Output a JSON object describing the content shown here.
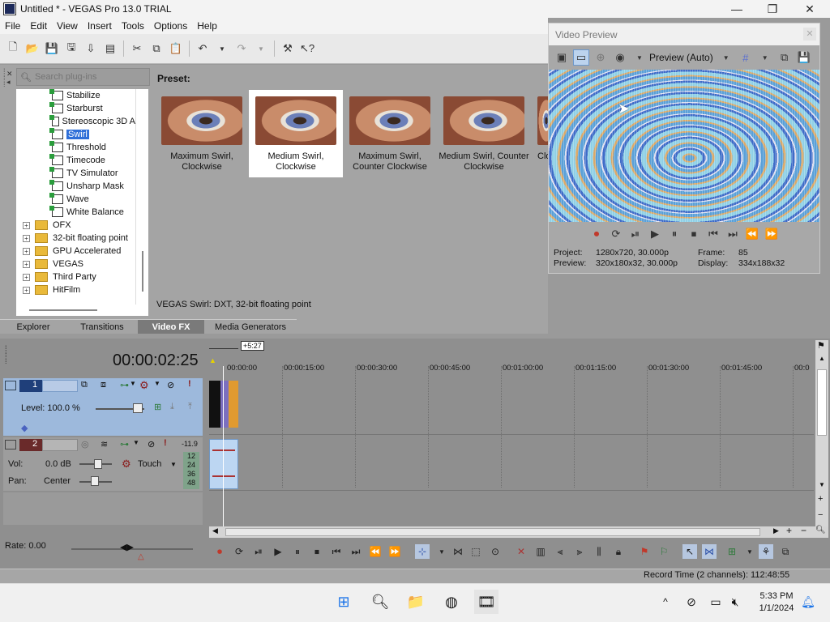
{
  "window": {
    "title": "Untitled * - VEGAS Pro 13.0 TRIAL",
    "minimize": "—",
    "maximize": "❐",
    "close": "✕"
  },
  "menu": [
    "File",
    "Edit",
    "View",
    "Insert",
    "Tools",
    "Options",
    "Help"
  ],
  "plugins": {
    "search_placeholder": "Search plug-ins",
    "fx_items": [
      "Stabilize",
      "Starburst",
      "Stereoscopic 3D A",
      "Swirl",
      "Threshold",
      "Timecode",
      "TV Simulator",
      "Unsharp Mask",
      "Wave",
      "White Balance"
    ],
    "selected": "Swirl",
    "folders": [
      "OFX",
      "32-bit floating point",
      "GPU Accelerated",
      "VEGAS",
      "Third Party",
      "HitFilm"
    ]
  },
  "presets": {
    "label": "Preset:",
    "items": [
      "Maximum Swirl, Clockwise",
      "Medium Swirl, Clockwise",
      "Maximum Swirl, Counter Clockwise",
      "Medium Swirl, Counter Clockwise",
      "Clo"
    ],
    "selected_index": 1
  },
  "fx_status": "VEGAS Swirl: DXT, 32-bit floating point",
  "tabs": [
    "Explorer",
    "Transitions",
    "Video FX",
    "Media Generators"
  ],
  "active_tab": "Video FX",
  "preview": {
    "title": "Video Preview",
    "mode": "Preview (Auto)",
    "project_label": "Project:",
    "project": "1280x720, 30.000p",
    "frame_label": "Frame:",
    "frame": "85",
    "preview_label": "Preview:",
    "preview_val": "320x180x32, 30.000p",
    "display_label": "Display:",
    "display": "334x188x32"
  },
  "timeline": {
    "timecode": "00:00:02:25",
    "marker": "+5:27",
    "ruler": [
      "00:00:00",
      "00:00:15:00",
      "00:00:30:00",
      "00:00:45:00",
      "00:01:00:00",
      "00:01:15:00",
      "00:01:30:00",
      "00:01:45:00",
      "00:0"
    ],
    "track1": {
      "number": "1",
      "level": "Level: 100.0 %"
    },
    "track2": {
      "number": "2",
      "vol_label": "Vol:",
      "vol": "0.0 dB",
      "pan_label": "Pan:",
      "pan": "Center",
      "touch": "Touch",
      "meter": "-11.9",
      "meter_scale": [
        "12",
        "24",
        "36",
        "48"
      ]
    }
  },
  "rate": "Rate: 0.00",
  "status": {
    "record_time": "Record Time (2 channels): 112:48:55"
  },
  "taskbar": {
    "time": "5:33 PM",
    "date": "1/1/2024"
  }
}
